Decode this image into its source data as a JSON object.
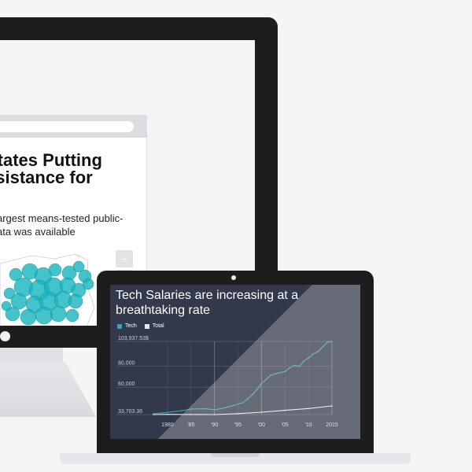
{
  "article": {
    "title": "States Putting\nssistance for\n?",
    "description": "argest means-tested public-\nata was available",
    "zoom_in_label": "+",
    "zoom_out_label": "−",
    "map_color": "#17b4bd"
  },
  "chart": {
    "title": "Tech Salaries are increasing at a breathtaking rate",
    "legend": [
      {
        "label": "Tech",
        "color": "#3aa2b5"
      },
      {
        "label": "Total",
        "color": "#e6e8ec"
      }
    ]
  },
  "chart_data": {
    "type": "line",
    "title": "Tech Salaries are increasing at a breathtaking rate",
    "xlabel": "",
    "ylabel": "",
    "x_tick_labels": [
      "1980",
      "'85",
      "'90",
      "'95",
      "'00",
      "'05",
      "'10",
      "2015"
    ],
    "y_tick_labels": [
      "103,937.53$",
      "80,000",
      "60,000",
      "33,703.36"
    ],
    "xlim": [
      1977,
      2015
    ],
    "ylim": [
      33703.36,
      103937.53
    ],
    "grid": true,
    "legend_position": "top-left",
    "series": [
      {
        "name": "Tech",
        "color": "#3aa2b5",
        "x": [
          1977,
          1980,
          1983,
          1985,
          1988,
          1990,
          1992,
          1994,
          1996,
          1997,
          1998,
          1999,
          2000,
          2001,
          2002,
          2003,
          2004,
          2005,
          2006,
          2007,
          2008,
          2009,
          2010,
          2011,
          2012,
          2013,
          2014,
          2015
        ],
        "y": [
          34500,
          35800,
          37400,
          39000,
          39300,
          38200,
          40000,
          42500,
          45000,
          48500,
          52500,
          57500,
          63500,
          67500,
          71500,
          73000,
          74000,
          75000,
          78500,
          81000,
          80000,
          85000,
          88000,
          92000,
          94000,
          98500,
          103000,
          103937.53
        ]
      },
      {
        "name": "Total",
        "color": "#e6e8ec",
        "x": [
          1977,
          1980,
          1985,
          1990,
          1995,
          2000,
          2005,
          2010,
          2015
        ],
        "y": [
          33703.36,
          33900,
          33800,
          33703.36,
          34600,
          36000,
          37800,
          39500,
          42000
        ]
      }
    ]
  }
}
